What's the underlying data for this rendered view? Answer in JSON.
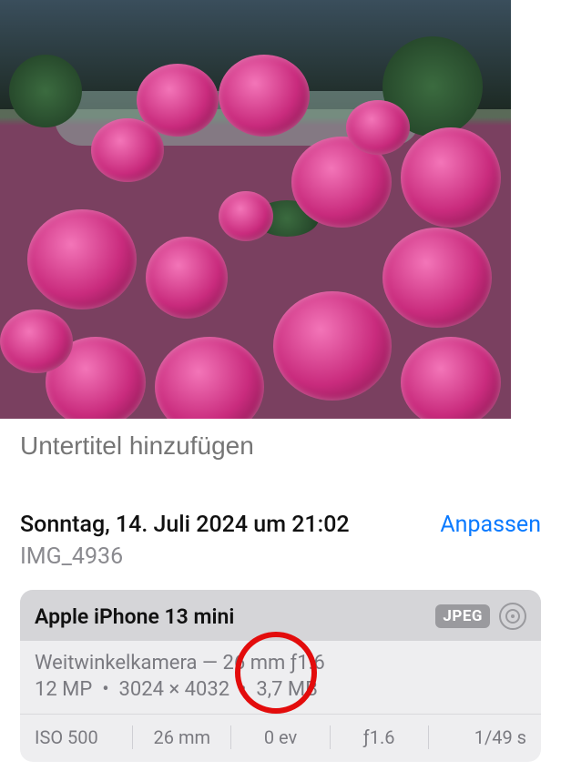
{
  "caption": {
    "placeholder": "Untertitel hinzufügen"
  },
  "info": {
    "date": "Sonntag, 14. Juli 2024 um 21:02",
    "adjust": "Anpassen",
    "filename": "IMG_4936"
  },
  "exif": {
    "device": "Apple iPhone 13 mini",
    "format_badge": "JPEG",
    "lens": "Weitwinkelkamera — 26 mm ƒ1.6",
    "megapixels": "12 MP",
    "dimensions": "3024 × 4032",
    "filesize": "3,7 MB",
    "iso": "ISO 500",
    "focal": "26 mm",
    "ev": "0 ev",
    "aperture": "ƒ1.6",
    "shutter": "1/49 s"
  }
}
